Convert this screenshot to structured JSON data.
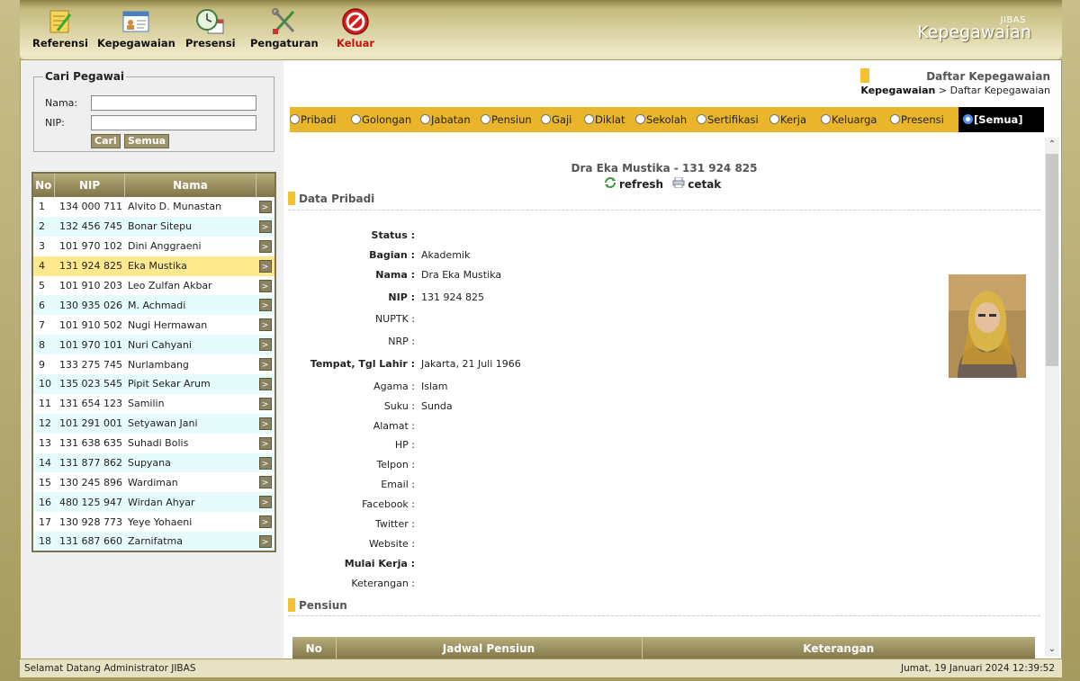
{
  "menu": [
    {
      "label": "Referensi",
      "icon": "notepad-pencil-icon"
    },
    {
      "label": "Kepegawaian",
      "icon": "id-card-icon"
    },
    {
      "label": "Presensi",
      "icon": "clock-calendar-icon"
    },
    {
      "label": "Pengaturan",
      "icon": "tools-icon"
    },
    {
      "label": "Keluar",
      "icon": "no-entry-icon"
    }
  ],
  "brand": {
    "small": "JIBAS",
    "big": "Kepegawaian"
  },
  "search": {
    "legend": "Cari Pegawai",
    "nama_label": "Nama:",
    "nip_label": "NIP:",
    "nama_value": "",
    "nip_value": "",
    "cari_label": "Cari",
    "semua_label": "Semua"
  },
  "employee_table": {
    "headers": [
      "No",
      "NIP",
      "Nama"
    ],
    "selected_index": 3,
    "rows": [
      {
        "no": "1",
        "nip": "134 000 711",
        "nama": "Alvito D. Munastan"
      },
      {
        "no": "2",
        "nip": "132 456 745",
        "nama": "Bonar Sitepu"
      },
      {
        "no": "3",
        "nip": "101 970 102",
        "nama": "Dini Anggraeni"
      },
      {
        "no": "4",
        "nip": "131 924 825",
        "nama": "Eka Mustika"
      },
      {
        "no": "5",
        "nip": "101 910 203",
        "nama": "Leo Zulfan Akbar"
      },
      {
        "no": "6",
        "nip": "130 935 026",
        "nama": "M. Achmadi"
      },
      {
        "no": "7",
        "nip": "101 910 502",
        "nama": "Nugi Hermawan"
      },
      {
        "no": "8",
        "nip": "101 970 101",
        "nama": "Nuri Cahyani"
      },
      {
        "no": "9",
        "nip": "133 275 745",
        "nama": "Nurlambang"
      },
      {
        "no": "10",
        "nip": "135 023 545",
        "nama": "Pipit Sekar Arum"
      },
      {
        "no": "11",
        "nip": "131 654 123",
        "nama": "Samilin"
      },
      {
        "no": "12",
        "nip": "101 291 001",
        "nama": "Setyawan Jani"
      },
      {
        "no": "13",
        "nip": "131 638 635",
        "nama": "Suhadi Bolis"
      },
      {
        "no": "14",
        "nip": "131 877 862",
        "nama": "Supyana"
      },
      {
        "no": "15",
        "nip": "130 245 896",
        "nama": "Wardiman"
      },
      {
        "no": "16",
        "nip": "480 125 947",
        "nama": "Wirdan Ahyar"
      },
      {
        "no": "17",
        "nip": "130 928 773",
        "nama": "Yeye Yohaeni"
      },
      {
        "no": "18",
        "nip": "131 687 660",
        "nama": "Zarnifatma"
      }
    ],
    "row_button": ">"
  },
  "page": {
    "title": "Daftar Kepegawaian",
    "breadcrumb_root": "Kepegawaian",
    "breadcrumb_sep": " > ",
    "breadcrumb_current": "Daftar Kepegawaian"
  },
  "tabs": [
    "Pribadi",
    "Golongan",
    "Jabatan",
    "Pensiun",
    "Gaji",
    "Diklat",
    "Sekolah",
    "Sertifikasi",
    "Kerja",
    "Keluarga",
    "Presensi",
    "[Semua]"
  ],
  "active_tab": "[Semua]",
  "employee": {
    "header": "Dra Eka Mustika - 131 924 825",
    "refresh_label": "refresh",
    "print_label": "cetak"
  },
  "sections": {
    "pribadi": "Data Pribadi",
    "pensiun": "Pensiun"
  },
  "fields": [
    {
      "label": "Status :",
      "value": "",
      "bold": true
    },
    {
      "label": "Bagian :",
      "value": "Akademik",
      "bold": true
    },
    {
      "label": "Nama :",
      "value": "Dra Eka Mustika",
      "bold": true
    },
    {
      "label": "NIP :",
      "value": "131 924 825",
      "bold": true
    },
    {
      "label": "NUPTK :",
      "value": "",
      "bold": false
    },
    {
      "label": "NRP :",
      "value": "",
      "bold": false
    },
    {
      "label": "Tempat, Tgl Lahir :",
      "value": "Jakarta, 21 Juli 1966",
      "bold": true
    },
    {
      "label": "Agama :",
      "value": "Islam",
      "bold": false
    },
    {
      "label": "Suku :",
      "value": "Sunda",
      "bold": false
    },
    {
      "label": "Alamat :",
      "value": "",
      "bold": false
    },
    {
      "label": "HP :",
      "value": "",
      "bold": false
    },
    {
      "label": "Telpon :",
      "value": "",
      "bold": false
    },
    {
      "label": "Email :",
      "value": "",
      "bold": false
    },
    {
      "label": "Facebook :",
      "value": "",
      "bold": false
    },
    {
      "label": "Twitter :",
      "value": "",
      "bold": false
    },
    {
      "label": "Website :",
      "value": "",
      "bold": false
    },
    {
      "label": "Mulai Kerja :",
      "value": "",
      "bold": true
    },
    {
      "label": "Keterangan :",
      "value": "",
      "bold": false
    }
  ],
  "pension_table": {
    "headers": [
      "No",
      "Jadwal Pensiun",
      "Keterangan"
    ]
  },
  "status_bar": {
    "left": "Selamat Datang Administrator JIBAS",
    "right": "Jumat, 19 Januari 2024 12:39:52"
  },
  "colors": {
    "accent_yellow": "#e9b52a",
    "selected_row": "#ffe98f",
    "header_brown": "#7f7447",
    "logout_red": "#c81010"
  }
}
